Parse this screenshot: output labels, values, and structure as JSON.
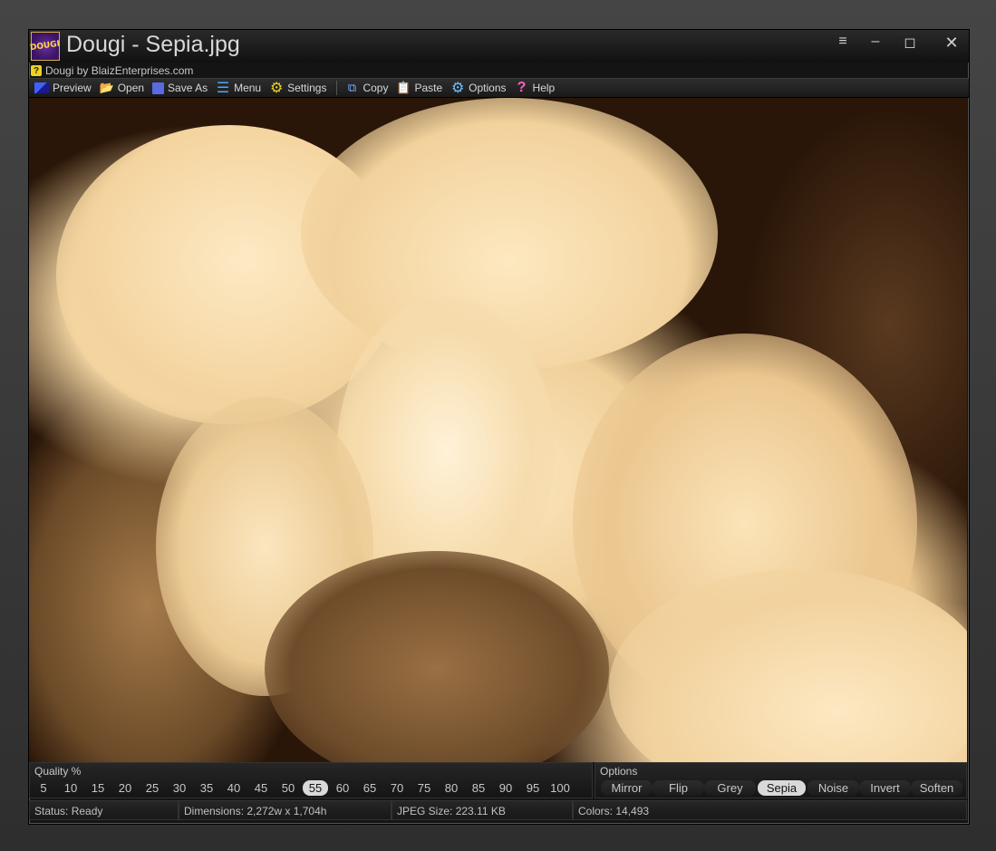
{
  "window": {
    "title": "Dougi - Sepia.jpg",
    "icon_label": "DOUGI",
    "subtitle": "Dougi by BlaizEnterprises.com",
    "controls": [
      "menu-lines-icon",
      "minimize-icon",
      "maximize-icon",
      "close-icon"
    ]
  },
  "toolbar": {
    "items": [
      {
        "label": "Preview",
        "icon": "preview-icon"
      },
      {
        "label": "Open",
        "icon": "folder-icon"
      },
      {
        "label": "Save As",
        "icon": "floppy-icon"
      },
      {
        "label": "Menu",
        "icon": "menu-icon"
      },
      {
        "label": "Settings",
        "icon": "gear-icon"
      },
      {
        "label": "Copy",
        "icon": "copy-icon"
      },
      {
        "label": "Paste",
        "icon": "paste-icon"
      },
      {
        "label": "Options",
        "icon": "options-gear-icon"
      },
      {
        "label": "Help",
        "icon": "help-icon"
      }
    ]
  },
  "quality": {
    "label": "Quality %",
    "values": [
      "5",
      "10",
      "15",
      "20",
      "25",
      "30",
      "35",
      "40",
      "45",
      "50",
      "55",
      "60",
      "65",
      "70",
      "75",
      "80",
      "85",
      "90",
      "95",
      "100"
    ],
    "selected": "55"
  },
  "options": {
    "label": "Options",
    "items": [
      "Mirror",
      "Flip",
      "Grey",
      "Sepia",
      "Noise",
      "Invert",
      "Soften"
    ],
    "selected": "Sepia"
  },
  "status": {
    "status": "Status: Ready",
    "dimensions": "Dimensions: 2,272w x 1,704h",
    "jpeg_size": "JPEG Size: 223.11 KB",
    "colors": "Colors: 14,493"
  },
  "colors": {
    "accent_selected": "#d9d9d9",
    "sepia_light": "#fbe5bb",
    "sepia_dark": "#2a1608"
  }
}
